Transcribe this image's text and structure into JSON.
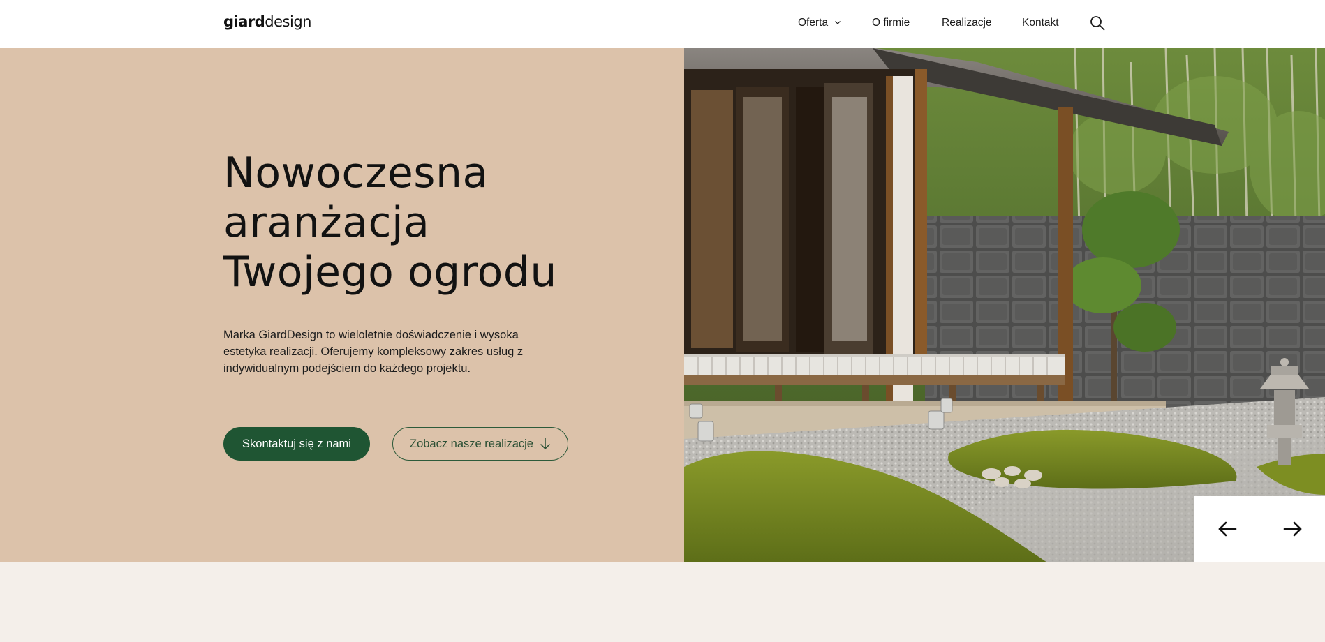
{
  "header": {
    "logo": {
      "strong": "giard",
      "light": "design"
    },
    "nav": {
      "offer_label": "Oferta",
      "about_label": "O firmie",
      "projects_label": "Realizacje",
      "contact_label": "Kontakt"
    },
    "search_icon": "search-icon"
  },
  "hero": {
    "title_lines": [
      "Nowoczesna",
      "aranżacja",
      "Twojego ogrodu"
    ],
    "description": "Marka GiardDesign to wieloletnie doświadczenie i wysoka estetyka realizacji. Oferujemy kompleksowy zakres usług z indywidualnym podejściem do każdego projektu.",
    "primary_button_label": "Skontaktuj się z nami",
    "secondary_button_label": "Zobacz nasze realizacje",
    "secondary_button_icon": "arrow-down-icon",
    "image_subject": "japanese-garden-photo"
  },
  "slider": {
    "prev_icon": "arrow-left-icon",
    "next_icon": "arrow-right-icon"
  },
  "colors": {
    "hero_background": "#dcc2aa",
    "primary_button": "#1f5533",
    "outline_button_border": "#2d5a3a",
    "page_background": "#f4efea",
    "header_background": "#ffffff"
  }
}
